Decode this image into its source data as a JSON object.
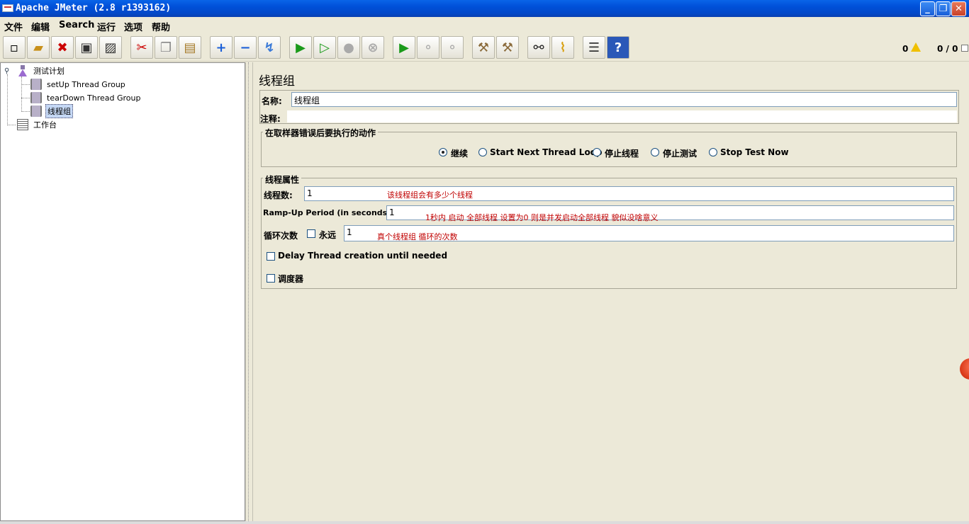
{
  "window": {
    "title": "Apache JMeter (2.8 r1393162)",
    "minimize": "_",
    "maximize": "❐",
    "close": "✕"
  },
  "menu": [
    "文件",
    "编辑",
    "Search",
    "运行",
    "选项",
    "帮助"
  ],
  "toolbar": {
    "icons": [
      "new-icon",
      "open-icon",
      "close-icon",
      "save-icon",
      "save-as-icon",
      "cut-icon",
      "copy-icon",
      "paste-icon",
      "expand-icon",
      "collapse-icon",
      "toggle-icon",
      "start-icon",
      "start-no-pause-icon",
      "stop-icon",
      "shutdown-icon",
      "remote-start-icon",
      "remote-stop-icon",
      "remote-shutdown-icon",
      "clear-icon",
      "clear-all-icon",
      "search-icon",
      "reset-search-icon",
      "function-helper-icon",
      "help-icon"
    ],
    "error_count": "0",
    "thread_count": "0 / 0"
  },
  "tree": {
    "root": "测试计划",
    "children": [
      "setUp Thread Group",
      "tearDown Thread Group",
      "线程组"
    ],
    "workbench": "工作台"
  },
  "panel": {
    "title": "线程组",
    "name_label": "名称:",
    "name_value": "线程组",
    "comment_label": "注释:",
    "sampler_error": {
      "title": "在取样器错误后要执行的动作",
      "options": [
        "继续",
        "Start Next Thread Loop",
        "停止线程",
        "停止测试",
        "Stop Test Now"
      ],
      "selected": "继续"
    },
    "thread_props": {
      "title": "线程属性",
      "threads_label": "线程数:",
      "threads_value": "1",
      "threads_note": "该线程组会有多少个线程",
      "rampup_label": "Ramp-Up Period (in seconds):",
      "rampup_value": "1",
      "rampup_note": "1秒内  启动  全部线程       设置为0  则是并发启动全部线程  貌似没啥意义",
      "loop_label": "循环次数",
      "forever_label": "永远",
      "loop_value": "1",
      "loop_note": "真个线程组  循环的次数",
      "delay_label": "Delay Thread creation until needed",
      "scheduler_label": "调度器"
    }
  }
}
